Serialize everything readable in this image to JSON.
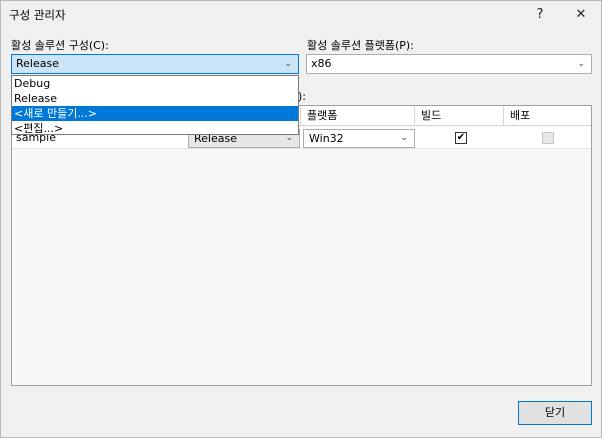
{
  "window": {
    "title": "구성 관리자",
    "help_label": "?",
    "close_label": "✕"
  },
  "solution_config": {
    "label": "활성 솔루션 구성(C):",
    "value": "Release",
    "options": [
      "Debug",
      "Release",
      "<새로 만들기...>",
      "<편집...>"
    ],
    "highlighted": "<새로 만들기...>"
  },
  "solution_platform": {
    "label": "활성 솔루션 플랫폼(P):",
    "value": "x86"
  },
  "hidden_label_tail": "):",
  "grid": {
    "headers": {
      "platform": "플랫폼",
      "build": "빌드",
      "deploy": "배포"
    },
    "rows": [
      {
        "project": "sample",
        "configuration": "Release",
        "platform": "Win32",
        "build": true,
        "deploy": false
      }
    ]
  },
  "footer": {
    "close_button": "닫기"
  },
  "icons": {
    "chevron": "chevron-down-icon",
    "check": "checkmark-icon"
  }
}
